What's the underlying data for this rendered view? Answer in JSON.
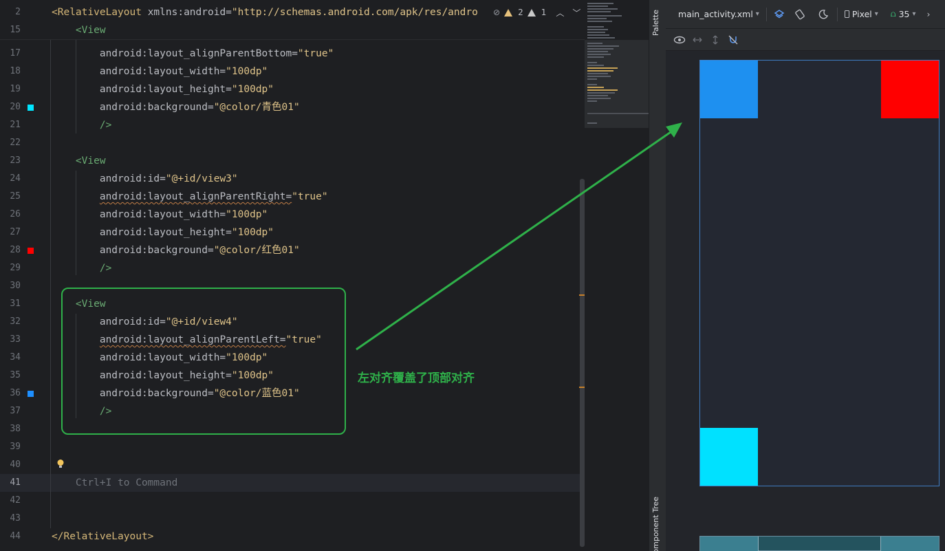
{
  "editor": {
    "sticky_lines": [
      {
        "num": "2",
        "parts": [
          {
            "cls": "tag",
            "t": "<RelativeLayout "
          },
          {
            "cls": "attrname",
            "t": "xmlns:android="
          },
          {
            "cls": "strval",
            "t": "\"http://schemas.android.com/apk/res/andro"
          }
        ]
      },
      {
        "num": "15",
        "parts": [
          {
            "cls": "tag-green",
            "t": "    <View"
          }
        ]
      }
    ],
    "lines": [
      {
        "num": "17",
        "parts": [
          {
            "cls": "attrname",
            "t": "        android:layout_alignParentBottom="
          },
          {
            "cls": "strval",
            "t": "\"true\""
          }
        ]
      },
      {
        "num": "18",
        "parts": [
          {
            "cls": "attrname",
            "t": "        android:layout_width="
          },
          {
            "cls": "strval",
            "t": "\"100dp\""
          }
        ]
      },
      {
        "num": "19",
        "parts": [
          {
            "cls": "attrname",
            "t": "        android:layout_height="
          },
          {
            "cls": "strval",
            "t": "\"100dp\""
          }
        ]
      },
      {
        "num": "20",
        "marker": "#00e5ff",
        "parts": [
          {
            "cls": "attrname",
            "t": "        android:background="
          },
          {
            "cls": "strval",
            "t": "\"@color/青色01\""
          }
        ]
      },
      {
        "num": "21",
        "parts": [
          {
            "cls": "tag-green",
            "t": "        />"
          }
        ]
      },
      {
        "num": "22",
        "parts": []
      },
      {
        "num": "23",
        "parts": [
          {
            "cls": "tag-green",
            "t": "    <View"
          }
        ]
      },
      {
        "num": "24",
        "parts": [
          {
            "cls": "attrname",
            "t": "        android:id="
          },
          {
            "cls": "strval",
            "t": "\"@+id/view3\""
          }
        ]
      },
      {
        "num": "25",
        "parts": [
          {
            "cls": "attrname squiggle",
            "t": "        android:layout_alignParentRight="
          },
          {
            "cls": "strval",
            "t": "\"true\""
          }
        ]
      },
      {
        "num": "26",
        "parts": [
          {
            "cls": "attrname",
            "t": "        android:layout_width="
          },
          {
            "cls": "strval",
            "t": "\"100dp\""
          }
        ]
      },
      {
        "num": "27",
        "parts": [
          {
            "cls": "attrname",
            "t": "        android:layout_height="
          },
          {
            "cls": "strval",
            "t": "\"100dp\""
          }
        ]
      },
      {
        "num": "28",
        "marker": "#ff0000",
        "parts": [
          {
            "cls": "attrname",
            "t": "        android:background="
          },
          {
            "cls": "strval",
            "t": "\"@color/红色01\""
          }
        ]
      },
      {
        "num": "29",
        "parts": [
          {
            "cls": "tag-green",
            "t": "        />"
          }
        ]
      },
      {
        "num": "30",
        "parts": []
      },
      {
        "num": "31",
        "parts": [
          {
            "cls": "tag-green",
            "t": "    <View"
          }
        ]
      },
      {
        "num": "32",
        "parts": [
          {
            "cls": "attrname",
            "t": "        android:id="
          },
          {
            "cls": "strval",
            "t": "\"@+id/view4\""
          }
        ]
      },
      {
        "num": "33",
        "parts": [
          {
            "cls": "attrname squiggle",
            "t": "        android:layout_alignParentLeft="
          },
          {
            "cls": "strval",
            "t": "\"true\""
          }
        ]
      },
      {
        "num": "34",
        "parts": [
          {
            "cls": "attrname",
            "t": "        android:layout_width="
          },
          {
            "cls": "strval",
            "t": "\"100dp\""
          }
        ]
      },
      {
        "num": "35",
        "parts": [
          {
            "cls": "attrname",
            "t": "        android:layout_height="
          },
          {
            "cls": "strval",
            "t": "\"100dp\""
          }
        ]
      },
      {
        "num": "36",
        "marker": "#1e8fff",
        "parts": [
          {
            "cls": "attrname",
            "t": "        android:background="
          },
          {
            "cls": "strval",
            "t": "\"@color/蓝色01\""
          }
        ]
      },
      {
        "num": "37",
        "parts": [
          {
            "cls": "tag-green",
            "t": "        />"
          }
        ]
      },
      {
        "num": "38",
        "parts": []
      },
      {
        "num": "39",
        "parts": []
      },
      {
        "num": "40",
        "parts": []
      },
      {
        "num": "41",
        "parts": [
          {
            "cls": "hint",
            "t": "    Ctrl+I to Command"
          }
        ]
      },
      {
        "num": "42",
        "parts": []
      },
      {
        "num": "43",
        "parts": []
      },
      {
        "num": "44",
        "parts": [
          {
            "cls": "tag",
            "t": "</RelativeLayout>"
          }
        ]
      }
    ],
    "warnings_count": "2",
    "weak_warnings_count": "1"
  },
  "side_tabs": {
    "palette": "Palette",
    "component_tree": "Component Tree"
  },
  "design_toolbar": {
    "file": "main_activity.xml",
    "device": "Pixel",
    "api": "35"
  },
  "preview": {
    "colors": {
      "blue": "#1e90f0",
      "red": "#ff0000",
      "cyan": "#00e1ff",
      "background": "#242832"
    }
  },
  "annotation": {
    "note": "左对齐覆盖了顶部对齐",
    "color": "#2fb14a"
  }
}
